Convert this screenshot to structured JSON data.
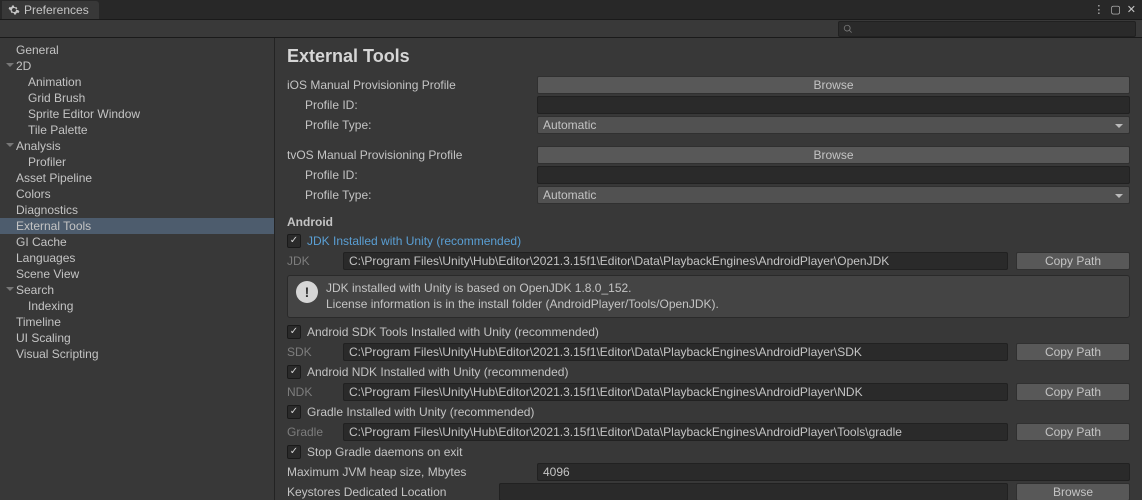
{
  "window": {
    "title": "Preferences"
  },
  "sidebar": {
    "items": [
      {
        "label": "General",
        "indent": 16,
        "expandable": false
      },
      {
        "label": "2D",
        "indent": 4,
        "expandable": true
      },
      {
        "label": "Animation",
        "indent": 28,
        "expandable": false
      },
      {
        "label": "Grid Brush",
        "indent": 28,
        "expandable": false
      },
      {
        "label": "Sprite Editor Window",
        "indent": 28,
        "expandable": false
      },
      {
        "label": "Tile Palette",
        "indent": 28,
        "expandable": false
      },
      {
        "label": "Analysis",
        "indent": 4,
        "expandable": true
      },
      {
        "label": "Profiler",
        "indent": 28,
        "expandable": false
      },
      {
        "label": "Asset Pipeline",
        "indent": 16,
        "expandable": false
      },
      {
        "label": "Colors",
        "indent": 16,
        "expandable": false
      },
      {
        "label": "Diagnostics",
        "indent": 16,
        "expandable": false
      },
      {
        "label": "External Tools",
        "indent": 16,
        "expandable": false,
        "selected": true
      },
      {
        "label": "GI Cache",
        "indent": 16,
        "expandable": false
      },
      {
        "label": "Languages",
        "indent": 16,
        "expandable": false
      },
      {
        "label": "Scene View",
        "indent": 16,
        "expandable": false
      },
      {
        "label": "Search",
        "indent": 4,
        "expandable": true
      },
      {
        "label": "Indexing",
        "indent": 28,
        "expandable": false
      },
      {
        "label": "Timeline",
        "indent": 16,
        "expandable": false
      },
      {
        "label": "UI Scaling",
        "indent": 16,
        "expandable": false
      },
      {
        "label": "Visual Scripting",
        "indent": 16,
        "expandable": false
      }
    ]
  },
  "content": {
    "title": "External Tools",
    "ios": {
      "title": "iOS Manual Provisioning Profile",
      "browse": "Browse",
      "profile_id_label": "Profile ID:",
      "profile_id_value": "",
      "profile_type_label": "Profile Type:",
      "profile_type_value": "Automatic"
    },
    "tvos": {
      "title": "tvOS Manual Provisioning Profile",
      "browse": "Browse",
      "profile_id_label": "Profile ID:",
      "profile_id_value": "",
      "profile_type_label": "Profile Type:",
      "profile_type_value": "Automatic"
    },
    "android": {
      "title": "Android",
      "jdk_check": "JDK Installed with Unity (recommended)",
      "jdk_label": "JDK",
      "jdk_path": "C:\\Program Files\\Unity\\Hub\\Editor\\2021.3.15f1\\Editor\\Data\\PlaybackEngines\\AndroidPlayer\\OpenJDK",
      "copy": "Copy Path",
      "info1": "JDK installed with Unity is based on OpenJDK 1.8.0_152.",
      "info2": "License information is in the install folder (AndroidPlayer/Tools/OpenJDK).",
      "sdk_check": "Android SDK Tools Installed with Unity (recommended)",
      "sdk_label": "SDK",
      "sdk_path": "C:\\Program Files\\Unity\\Hub\\Editor\\2021.3.15f1\\Editor\\Data\\PlaybackEngines\\AndroidPlayer\\SDK",
      "ndk_check": "Android NDK Installed with Unity (recommended)",
      "ndk_label": "NDK",
      "ndk_path": "C:\\Program Files\\Unity\\Hub\\Editor\\2021.3.15f1\\Editor\\Data\\PlaybackEngines\\AndroidPlayer\\NDK",
      "gradle_check": "Gradle Installed with Unity (recommended)",
      "gradle_label": "Gradle",
      "gradle_path": "C:\\Program Files\\Unity\\Hub\\Editor\\2021.3.15f1\\Editor\\Data\\PlaybackEngines\\AndroidPlayer\\Tools\\gradle",
      "stop_daemons": "Stop Gradle daemons on exit",
      "jvm_label": "Maximum JVM heap size, Mbytes",
      "jvm_value": "4096",
      "keystore_label": "Keystores Dedicated Location",
      "keystore_value": "",
      "browse": "Browse"
    }
  }
}
